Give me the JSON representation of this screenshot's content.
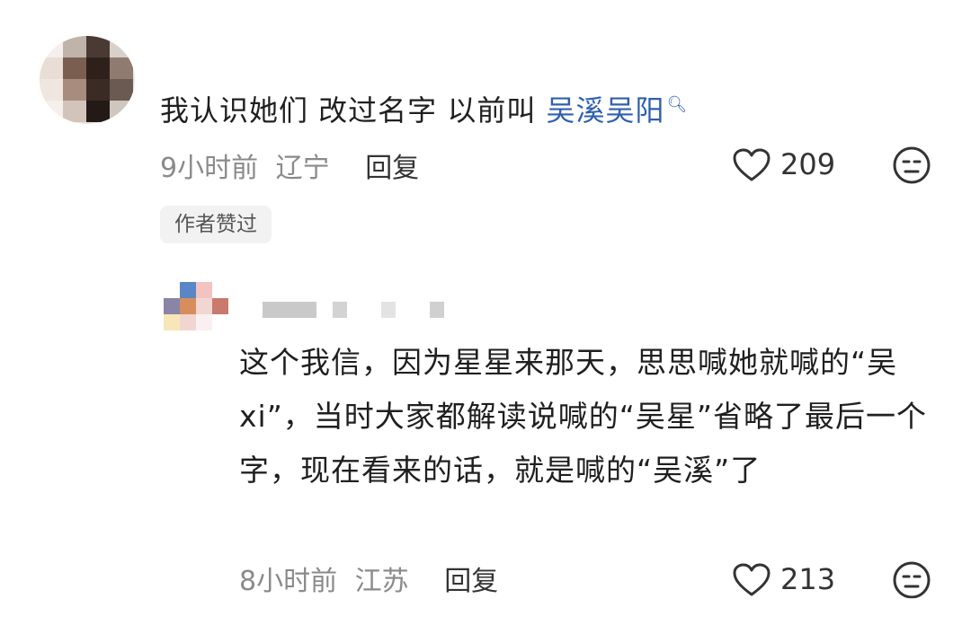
{
  "comment1": {
    "text_plain": "我认识她们 改过名字 以前叫 ",
    "text_link": "吴溪吴阳",
    "time": "9小时前",
    "location": "辽宁",
    "reply_label": "回复",
    "like_count": "209",
    "badge": "作者赞过"
  },
  "comment2": {
    "text": "这个我信，因为星星来那天，思思喊她就喊的“吴 xi”，当时大家都解读说喊的“吴星”省略了最后一个字，现在看来的话，就是喊的“吴溪”了",
    "time": "8小时前",
    "location": "江苏",
    "reply_label": "回复",
    "like_count": "213"
  },
  "icons": {
    "like": "heart-outline-icon",
    "dislike": "neutral-face-icon",
    "link": "search-icon"
  },
  "colors": {
    "link": "#2f5fae",
    "meta": "#8a8a8a",
    "badge_bg": "#f2f2f2"
  }
}
